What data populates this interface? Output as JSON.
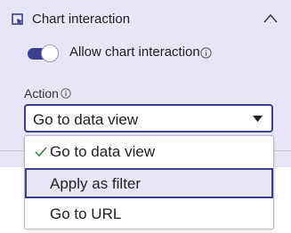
{
  "section": {
    "title": "Chart interaction",
    "icon": "chart-cursor-icon",
    "collapse_icon": "chevron-up-icon"
  },
  "toggle": {
    "label": "Allow chart interaction",
    "checked": true,
    "info_icon": "info-icon"
  },
  "action": {
    "label": "Action",
    "info_icon": "info-icon",
    "selected": "Go to data view",
    "options": [
      {
        "label": "Go to data view",
        "checked": true
      },
      {
        "label": "Apply as filter",
        "highlighted": true
      },
      {
        "label": "Go to URL"
      }
    ]
  },
  "colors": {
    "accent": "#3b3f8f",
    "panel_bg": "#e6e6f6"
  }
}
